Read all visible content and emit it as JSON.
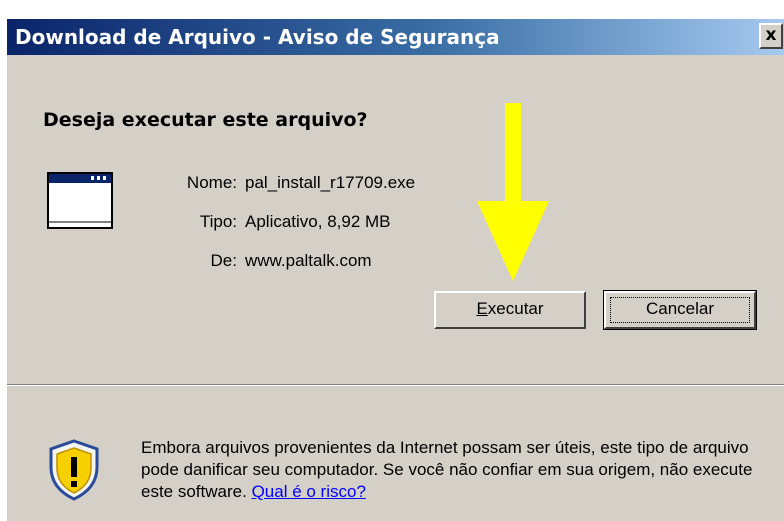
{
  "window": {
    "title": "Download de Arquivo - Aviso de Segurança",
    "close_glyph": "x"
  },
  "dialog": {
    "question": "Deseja executar este arquivo?",
    "file_icon": "application-window-icon",
    "fields": [
      {
        "label": "Nome:",
        "value": "pal_install_r17709.exe"
      },
      {
        "label": "Tipo:",
        "value": "Aplicativo, 8,92 MB"
      },
      {
        "label": "De:",
        "value": "www.paltalk.com"
      }
    ],
    "arrow_color": "#ffff00",
    "buttons": {
      "run": {
        "mnemonic": "E",
        "rest": "xecutar"
      },
      "cancel": {
        "label": "Cancelar"
      }
    },
    "warning": {
      "icon": "security-shield-warning-icon",
      "text": "Embora arquivos provenientes da Internet possam ser úteis, este tipo de arquivo pode danificar seu computador. Se você não confiar em sua origem, não execute este software. ",
      "link": "Qual é o risco?"
    }
  },
  "colors": {
    "title_bar_start": "#0a246a",
    "title_bar_end": "#a6caf0",
    "dialog_bg": "#d4d0c8",
    "link": "#0000ff"
  }
}
